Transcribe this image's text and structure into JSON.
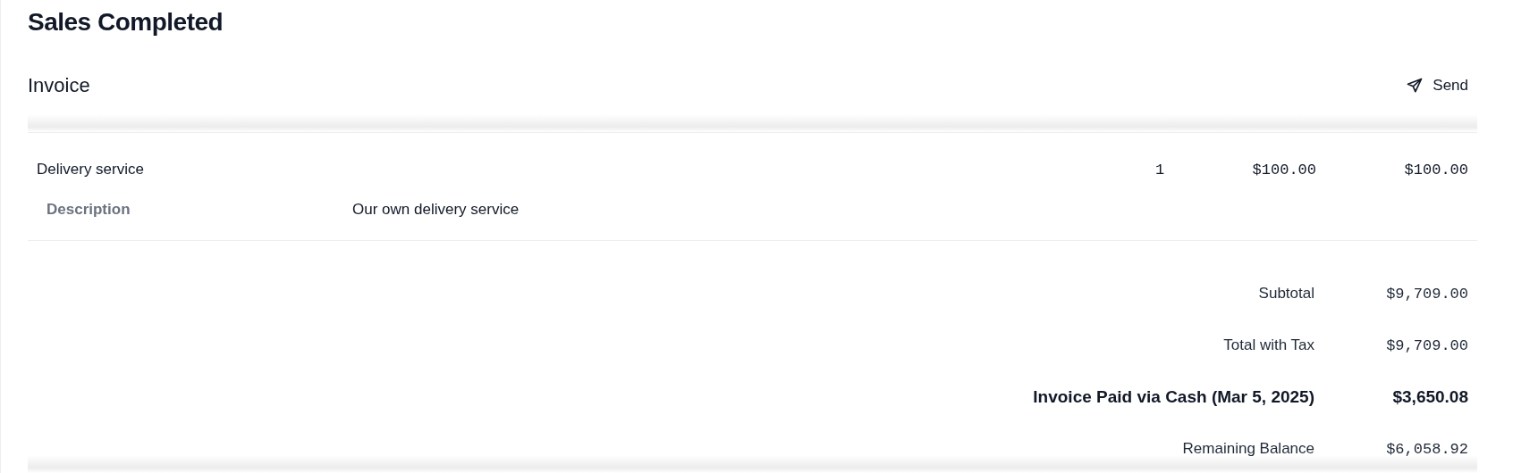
{
  "page_title": "Sales Completed",
  "invoice": {
    "title": "Invoice",
    "send_button": "Send"
  },
  "line_items": [
    {
      "name": "Delivery service",
      "quantity": "1",
      "unit_price": "$100.00",
      "amount": "$100.00",
      "detail_label": "Description",
      "detail_value": "Our own delivery service"
    }
  ],
  "totals": [
    {
      "label": "Subtotal",
      "value": "$9,709.00",
      "emphasized": false
    },
    {
      "label": "Total with Tax",
      "value": "$9,709.00",
      "emphasized": false
    },
    {
      "label": "Invoice Paid via Cash (Mar 5, 2025)",
      "value": "$3,650.08",
      "emphasized": true
    },
    {
      "label": "Remaining Balance",
      "value": "$6,058.92",
      "emphasized": false
    }
  ]
}
